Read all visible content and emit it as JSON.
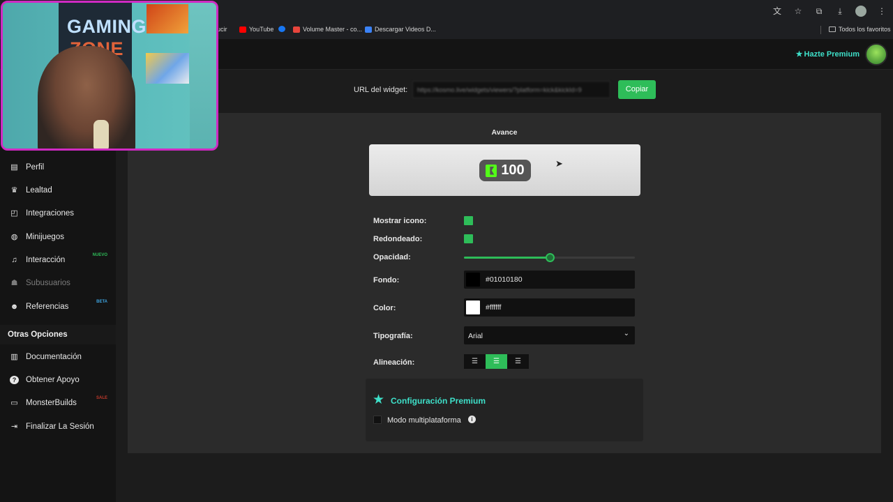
{
  "browser": {
    "bookmarks": [
      {
        "label": "ducir",
        "color": "#1e1f22"
      },
      {
        "label": "YouTube",
        "color": "#ff0000"
      },
      {
        "label": "",
        "color": "#1877f2"
      },
      {
        "label": "Volume Master - co...",
        "color": "#e8453c"
      },
      {
        "label": "Descargar Videos D...",
        "color": "#3b82f6"
      }
    ],
    "all_bookmarks": "Todos los favoritos"
  },
  "topbar": {
    "premium_label": "Hazte Premium"
  },
  "sidebar": {
    "items": [
      {
        "label": "Perfil",
        "icon": "id-card-icon",
        "glyph": "▤"
      },
      {
        "label": "Lealtad",
        "icon": "trophy-icon",
        "glyph": "♛"
      },
      {
        "label": "Integraciones",
        "icon": "plug-icon",
        "glyph": "◰"
      },
      {
        "label": "Minijuegos",
        "icon": "gamepad-icon",
        "glyph": "◍"
      },
      {
        "label": "Interacción",
        "icon": "music-icon",
        "glyph": "♫",
        "badge": "NUEVO",
        "badge_color": "#2ebd59"
      },
      {
        "label": "Subusuarios",
        "icon": "users-group-icon",
        "glyph": "☗",
        "disabled": true
      },
      {
        "label": "Referencias",
        "icon": "users-icon",
        "glyph": "☻",
        "badge": "BETA",
        "badge_color": "#3ea4e0"
      }
    ],
    "other_heading": "Otras Opciones",
    "other_items": [
      {
        "label": "Documentación",
        "icon": "document-icon",
        "glyph": "▥"
      },
      {
        "label": "Obtener Apoyo",
        "icon": "question-icon",
        "glyph": "?"
      },
      {
        "label": "MonsterBuilds",
        "icon": "laptop-icon",
        "glyph": "▭",
        "badge": "SALE",
        "badge_color": "#c0392b"
      },
      {
        "label": "Finalizar La Sesión",
        "icon": "logout-icon",
        "glyph": "⇥"
      }
    ]
  },
  "widget": {
    "url_label": "URL del widget:",
    "url_value": "https://kosmo.live/widgets/viewers/?platform=kick&kickId=9",
    "copy_label": "Copiar"
  },
  "settings": {
    "section_title": "Avance",
    "preview_value": "100",
    "show_icon_label": "Mostrar icono:",
    "show_icon": true,
    "rounded_label": "Redondeado:",
    "rounded": true,
    "opacity_label": "Opacidad:",
    "opacity": 0.5,
    "background_label": "Fondo:",
    "background_value": "#01010180",
    "color_label": "Color:",
    "color_value": "#ffffff",
    "typography_label": "Tipografía:",
    "typography_value": "Arial",
    "alignment_label": "Alineación:",
    "alignment": "center"
  },
  "premium": {
    "title": "Configuración Premium",
    "multiplatform_label": "Modo multiplataforma"
  },
  "webcam": {
    "poster_line1": "GAMING",
    "poster_line2": "ZONE"
  },
  "colors": {
    "accent_green": "#2ebd59",
    "accent_teal": "#3ee0c9",
    "kick_green": "#53fc18",
    "webcam_border": "#d02ac3"
  }
}
